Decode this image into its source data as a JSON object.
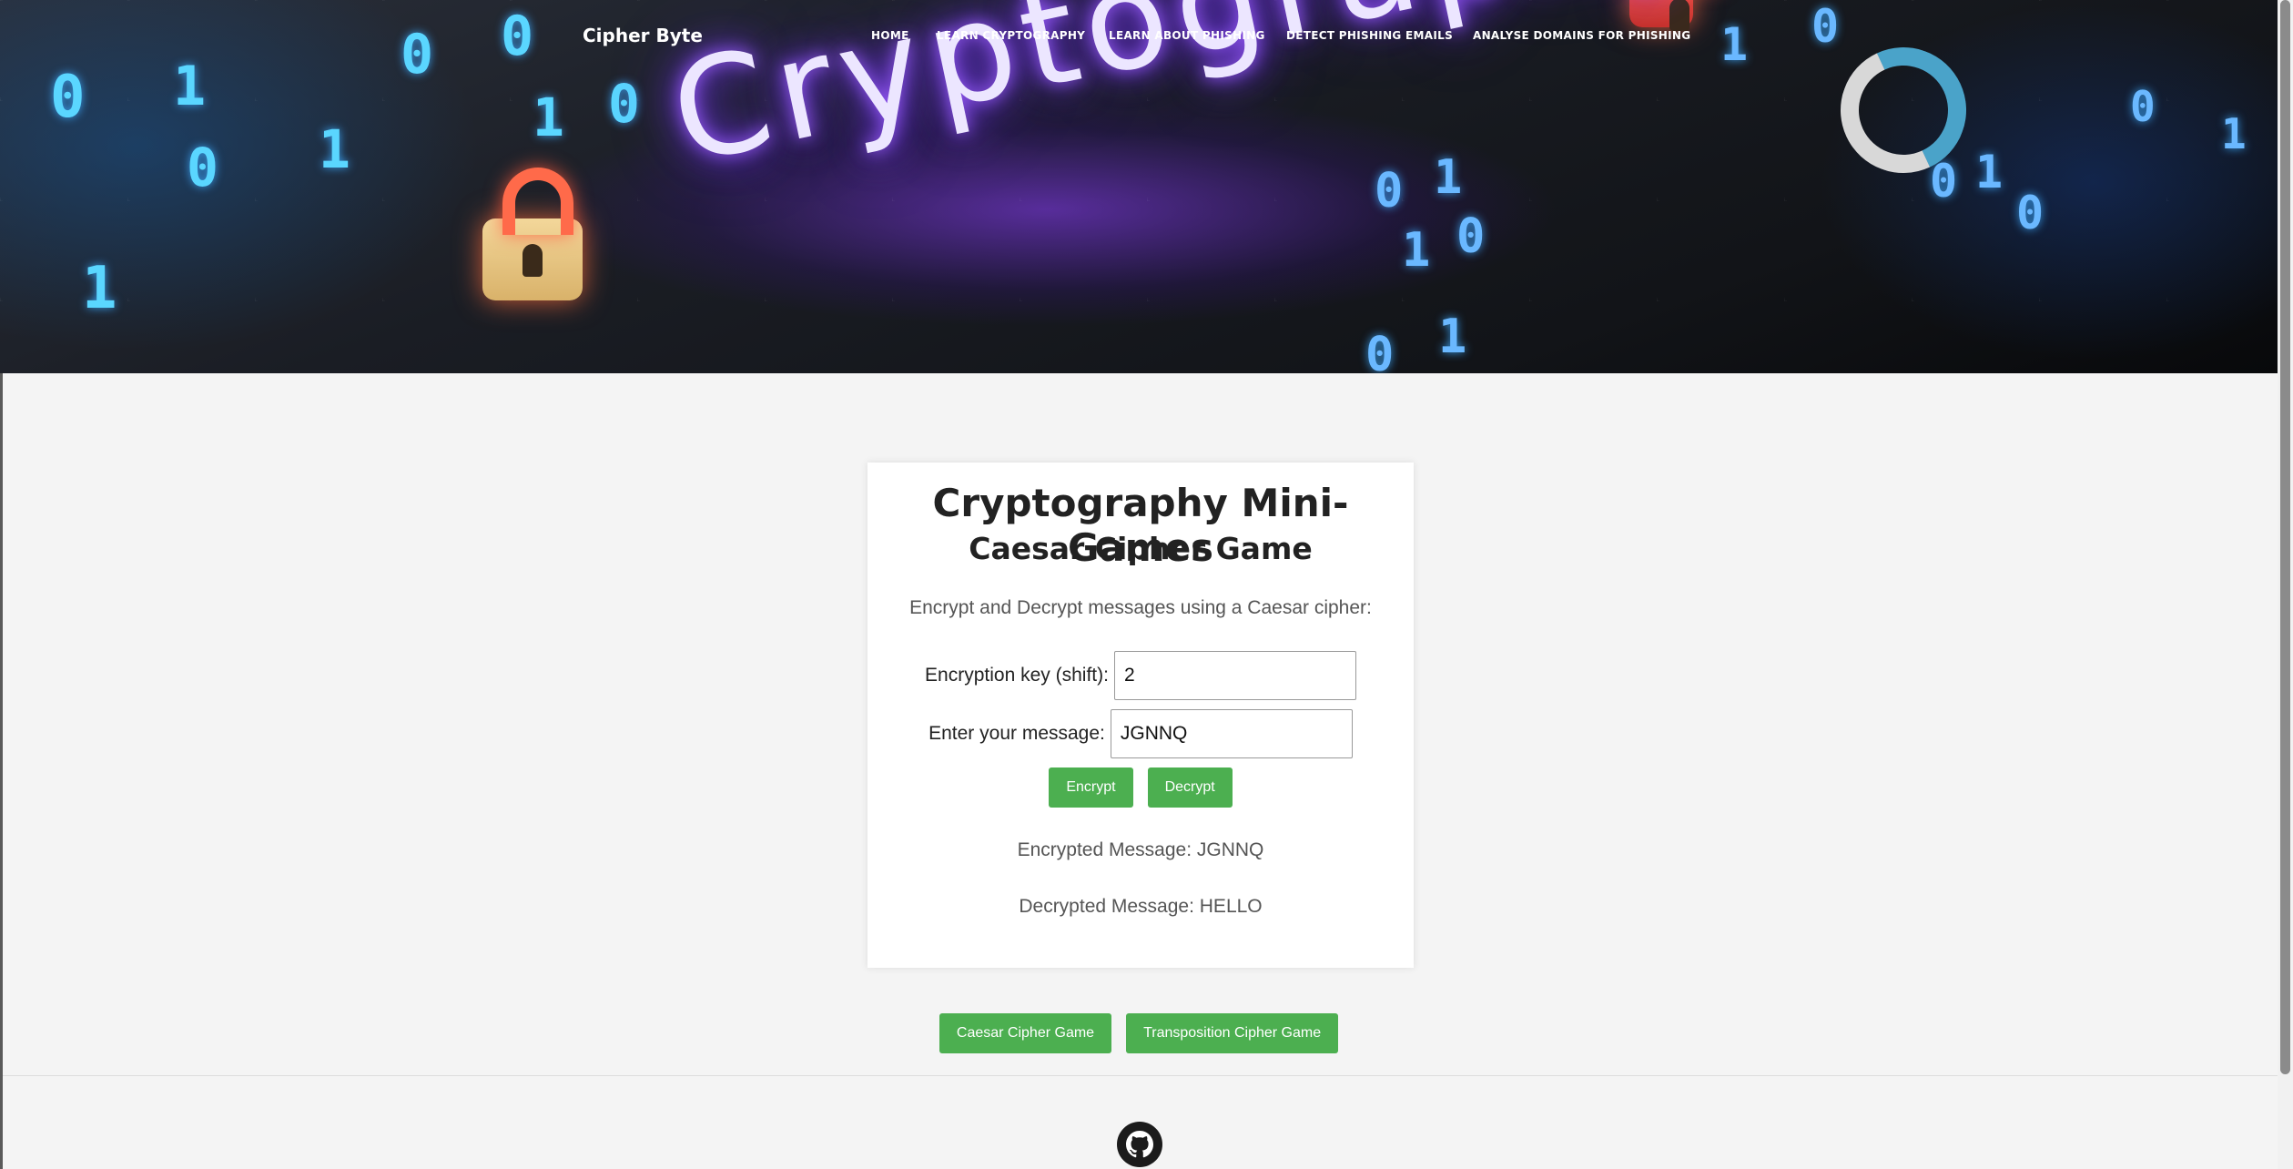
{
  "header": {
    "brand": "Cipher Byte",
    "nav": [
      {
        "label": "HOME"
      },
      {
        "label": "LEARN CRYPTOGRAPHY"
      },
      {
        "label": "LEARN ABOUT PHISHING"
      },
      {
        "label": "DETECT PHISHING EMAILS"
      },
      {
        "label": "ANALYSE DOMAINS FOR PHISHING"
      }
    ],
    "banner_word": "Cryptography",
    "loader_icon": "refresh-spinner-icon"
  },
  "card": {
    "title": "Cryptography Mini-Games",
    "subtitle": "Caesar Cipher Game",
    "description": "Encrypt and Decrypt messages using a Caesar cipher:",
    "key_label": "Encryption key (shift):",
    "key_value": "2",
    "message_label": "Enter your message:",
    "message_value": "JGNNQ",
    "encrypt_label": "Encrypt",
    "decrypt_label": "Decrypt",
    "encrypted_result": "Encrypted Message: JGNNQ",
    "decrypted_result": "Decrypted Message: HELLO"
  },
  "games": {
    "caesar_label": "Caesar Cipher Game",
    "transposition_label": "Transposition Cipher Game"
  },
  "footer": {
    "icon": "github-icon"
  },
  "colors": {
    "accent_button": "#4caf50",
    "page_background": "#f4f4f4",
    "card_background": "#ffffff"
  }
}
